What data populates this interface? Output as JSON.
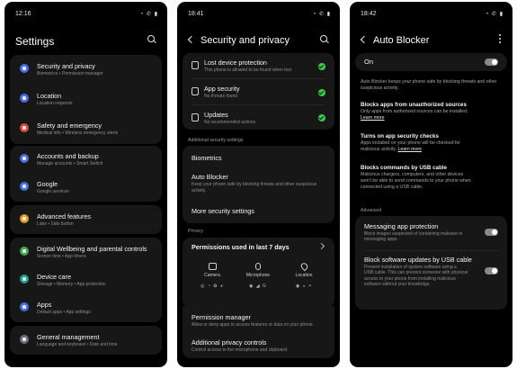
{
  "screen1": {
    "time": "12:16",
    "title": "Settings",
    "items": [
      {
        "title": "Security and privacy",
        "sub": "Biometrics • Permission manager",
        "color": "#4a6de8",
        "icon": "shield-icon"
      },
      {
        "title": "Location",
        "sub": "Location requests",
        "color": "#4a6de8",
        "icon": "location-pin-icon"
      },
      {
        "title": "Safety and emergency",
        "sub": "Medical info • Wireless emergency alerts",
        "color": "#d94a3c",
        "icon": "emergency-icon"
      },
      {
        "title": "Accounts and backup",
        "sub": "Manage accounts • Smart Switch",
        "color": "#4a6de8",
        "icon": "sync-icon"
      },
      {
        "title": "Google",
        "sub": "Google services",
        "color": "#3f75e0",
        "icon": "google-icon"
      },
      {
        "title": "Advanced features",
        "sub": "Labs • Side button",
        "color": "#e29a2c",
        "icon": "star-gear-icon"
      },
      {
        "title": "Digital Wellbeing and parental controls",
        "sub": "Screen time • App timers",
        "color": "#43a84a",
        "icon": "wellbeing-icon"
      },
      {
        "title": "Device care",
        "sub": "Storage • Memory • App protection",
        "color": "#1da08c",
        "icon": "device-care-icon"
      },
      {
        "title": "Apps",
        "sub": "Default apps • App settings",
        "color": "#4a6de8",
        "icon": "apps-grid-icon"
      },
      {
        "title": "General management",
        "sub": "Language and keyboard • Date and time",
        "color": "#6a6f80",
        "icon": "sliders-icon"
      }
    ]
  },
  "screen2": {
    "time": "18:41",
    "title": "Security and privacy",
    "status_items": [
      {
        "title": "Lost device protection",
        "sub": "This phone is allowed to be found when lost",
        "icon": "phone-lock-icon"
      },
      {
        "title": "App security",
        "sub": "No threats found",
        "icon": "apps-shield-icon"
      },
      {
        "title": "Updates",
        "sub": "No recommended actions",
        "icon": "update-icon"
      }
    ],
    "additional_label": "Additional security settings",
    "additional_items": [
      {
        "title": "Biometrics",
        "sub": ""
      },
      {
        "title": "Auto Blocker",
        "sub": "Keep your phone safe by blocking threats and other suspicious activity."
      },
      {
        "title": "More security settings",
        "sub": ""
      }
    ],
    "privacy_label": "Privacy",
    "permissions": {
      "title": "Permissions used in last 7 days",
      "columns": [
        {
          "label": "Camera",
          "apps": "◎ ◔ ✿ ◕",
          "icon": "camera-icon"
        },
        {
          "label": "Microphone",
          "apps": "◉ ◢ G",
          "icon": "microphone-icon"
        },
        {
          "label": "Location",
          "apps": "◉ ◒ ◓",
          "icon": "location-icon"
        }
      ]
    },
    "privacy_items": [
      {
        "title": "Permission manager",
        "sub": "Allow or deny apps to access features or data on your phone."
      },
      {
        "title": "Additional privacy controls",
        "sub": "Control access to the microphone and clipboard."
      }
    ]
  },
  "screen3": {
    "time": "18:42",
    "title": "Auto Blocker",
    "on_label": "On",
    "intro": "Auto Blocker keeps your phone safe by blocking threats and other suspicious activity.",
    "features": [
      {
        "title": "Blocks apps from unauthorized sources",
        "lines": [
          "Only apps from authorized sources can be installed."
        ],
        "link": "Learn more"
      },
      {
        "title": "Turns on app security checks",
        "lines": [
          "Apps installed on your phone will be checked for",
          "malicious activity."
        ],
        "link": "Learn more"
      },
      {
        "title": "Blocks commands by USB cable",
        "lines": [
          "Malicious chargers, computers, and other devices",
          "won't be able to send commands to your phone when",
          "connected using a USB cable."
        ],
        "link": ""
      }
    ],
    "advanced_label": "Advanced",
    "advanced_items": [
      {
        "title": "Messaging app protection",
        "lines": [
          "Block images suspected of containing malware in",
          "messaging apps."
        ]
      },
      {
        "title": "Block software updates by USB cable",
        "lines": [
          "Prevent installation of system software using a",
          "USB cable. This can prevent someone with physical",
          "access to your phone from installing malicious",
          "software without your knowledge."
        ]
      }
    ]
  },
  "status_icons": "◔ ✆ ▮",
  "colors": {
    "background": "#000000",
    "card": "#171717",
    "check": "#3ec84a"
  }
}
